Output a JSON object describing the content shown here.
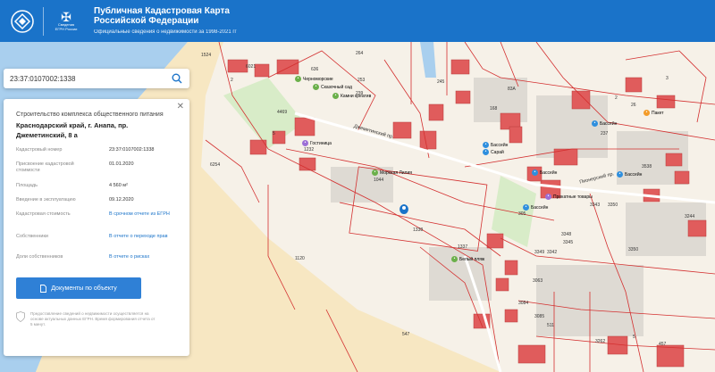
{
  "header": {
    "title_line1": "Публичная Кадастровая Карта",
    "title_line2": "Российской Федерации",
    "subtitle": "Официальные сведения о недвижимости за 1998-2021 гг",
    "emblem_line1": "Сведения",
    "emblem_line2": "ЕГРН России"
  },
  "search": {
    "value": "23:37:0107002:1338"
  },
  "card": {
    "title": "Строительство комплекса общественного питания",
    "address": "Краснодарский край, г. Анапа, пр. Джеметинский, 8 а",
    "rows": [
      {
        "label": "Кадастровый номер",
        "value": "23:37:0107002:1338"
      },
      {
        "label": "Присвоение кадастровой стоимости",
        "value": "01.01.2020"
      },
      {
        "label": "Площадь",
        "value": "4 560 м²"
      },
      {
        "label": "Введение в эксплуатацию",
        "value": "09.12.2020"
      },
      {
        "label": "Кадастровая стоимость",
        "value": "В срочном отчете из ЕГРН"
      },
      {
        "label": "Собственники",
        "value": "В отчете о переходе прав"
      },
      {
        "label": "Доли собственников",
        "value": "В отчете о рисках"
      }
    ],
    "doc_button": "Документы по объекту",
    "note": "Предоставление сведений о недвижимости осуществляется на основе актуальных данных ЕГРН. Время формирования отчета от 5 минут."
  },
  "map": {
    "labels": [
      {
        "t": "1524"
      },
      {
        "t": "6021"
      },
      {
        "t": "2"
      },
      {
        "t": "264"
      },
      {
        "t": "253"
      },
      {
        "t": "239"
      },
      {
        "t": "636"
      },
      {
        "t": "4469"
      },
      {
        "t": "5"
      },
      {
        "t": "1232"
      },
      {
        "t": "6254"
      },
      {
        "t": "1120"
      },
      {
        "t": "1044"
      },
      {
        "t": "1338"
      },
      {
        "t": "245"
      },
      {
        "t": "83А"
      },
      {
        "t": "168"
      },
      {
        "t": "2"
      },
      {
        "t": "3"
      },
      {
        "t": "237"
      },
      {
        "t": "26"
      },
      {
        "t": "3538"
      },
      {
        "t": "3343"
      },
      {
        "t": "3350"
      },
      {
        "t": "3349"
      },
      {
        "t": "3342"
      },
      {
        "t": "3063"
      },
      {
        "t": "1337"
      },
      {
        "t": "3084"
      },
      {
        "t": "3085"
      },
      {
        "t": "511"
      },
      {
        "t": "3262"
      },
      {
        "t": "547"
      },
      {
        "t": "305"
      },
      {
        "t": "3348"
      },
      {
        "t": "3345"
      },
      {
        "t": "3350"
      },
      {
        "t": "3244"
      },
      {
        "t": "5"
      },
      {
        "t": "457"
      }
    ],
    "street": "Джеметинский пр.",
    "street2": "Пионерский пр.",
    "pois": [
      {
        "t": "Черноморские"
      },
      {
        "t": "Сказочный сад"
      },
      {
        "t": "Камни креатив"
      },
      {
        "t": "Гостиница"
      },
      {
        "t": "Морская Лилия"
      },
      {
        "t": "Сарай"
      },
      {
        "t": "Бассейн"
      },
      {
        "t": "Бассейн"
      },
      {
        "t": "Бассейн"
      },
      {
        "t": "Бассейн"
      },
      {
        "t": "Пакет"
      },
      {
        "t": "Прокатные товары"
      },
      {
        "t": "Белый пляж"
      },
      {
        "t": "Бассейн"
      }
    ]
  },
  "colors": {
    "header": "#1a73c9",
    "parcel_line": "#d32f2f",
    "building": "#e05c5c",
    "sand": "#f7e7c2",
    "sea": "#a9cfee"
  }
}
